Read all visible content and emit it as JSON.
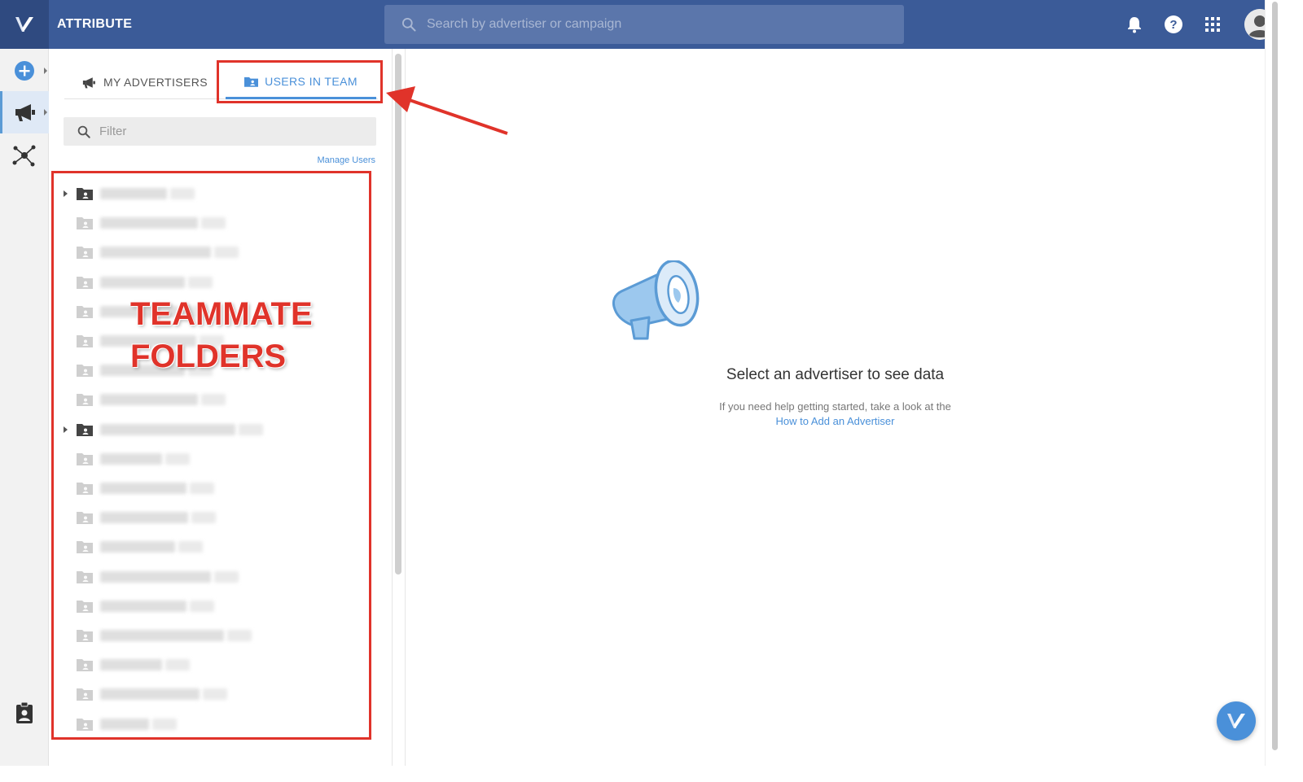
{
  "header": {
    "app_title": "ATTRIBUTE",
    "search_placeholder": "Search by advertiser or campaign",
    "icons": [
      "bell-icon",
      "help-icon",
      "apps-grid-icon",
      "account-avatar"
    ]
  },
  "rail": {
    "items": [
      "add-icon",
      "megaphone-icon",
      "network-icon"
    ],
    "bottom_item": "clipboard-user-icon"
  },
  "panel": {
    "tabs": [
      {
        "label": "MY ADVERTISERS",
        "icon": "megaphone-icon",
        "active": false
      },
      {
        "label": "USERS IN TEAM",
        "icon": "user-folder-icon",
        "active": true
      }
    ],
    "filter_placeholder": "Filter",
    "manage_users_label": "Manage Users",
    "tree_rows": 19
  },
  "annotation": {
    "label_line1": "TEAMMATE",
    "label_line2": "FOLDERS",
    "color": "#e0332a"
  },
  "main": {
    "empty_title": "Select an advertiser to see data",
    "help_text": "If you need help getting started, take a look at the",
    "help_link": "How to Add an Advertiser"
  },
  "colors": {
    "topbar": "#3b5b98",
    "accent": "#4a90d9"
  }
}
